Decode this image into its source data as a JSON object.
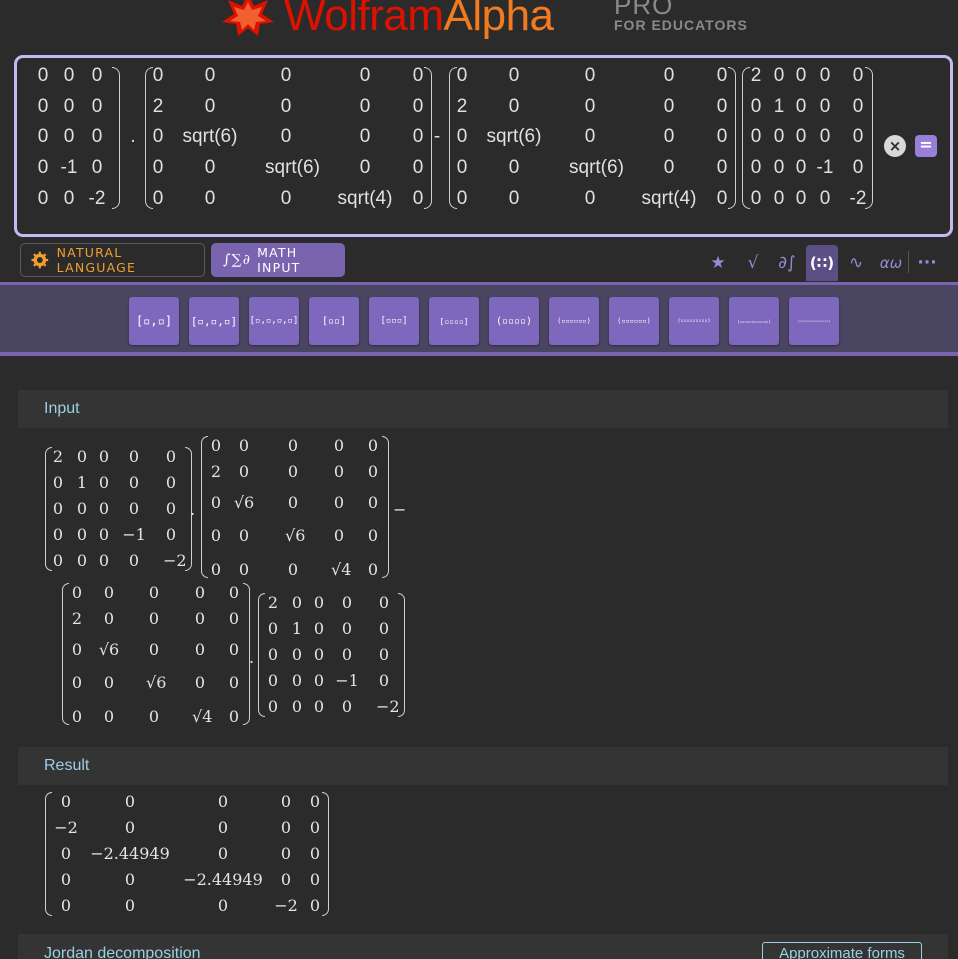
{
  "brand": {
    "name_part1": "Wolfram",
    "name_part2": "Alpha",
    "tier": "PRO",
    "audience": "FOR EDUCATORS"
  },
  "query": {
    "tokens": [
      "0",
      "0",
      "0",
      "0",
      "0",
      "0",
      "0",
      "0",
      "0",
      "0",
      "-1",
      "0",
      "0",
      "0",
      "-2",
      ".",
      "0",
      "0",
      "0",
      "0",
      "0",
      "2",
      "0",
      "0",
      "0",
      "0",
      "0",
      "sqrt(6)",
      "0",
      "0",
      "0",
      "0",
      "0",
      "sqrt(6)",
      "0",
      "0",
      "0",
      "0",
      "0",
      "sqrt(4)",
      "0",
      "-",
      "0",
      "0",
      "0",
      "0",
      "0",
      "2",
      "0",
      "0",
      "0",
      "0",
      "0",
      "sqrt(6)",
      "0",
      "0",
      "0",
      "0",
      "0",
      "sqrt(6)",
      "0",
      "0",
      "0",
      "0",
      "0",
      "sqrt(4)",
      "0",
      "2",
      "0",
      "0",
      "0",
      "0",
      "0",
      "1",
      "0",
      "0",
      "0",
      "0",
      "0",
      "0",
      "0",
      "0",
      "0",
      "0",
      "0",
      "-1",
      "0",
      "0",
      "0",
      "0",
      "0",
      "-2"
    ]
  },
  "buttons": {
    "clear": "×",
    "compute": "="
  },
  "modes": {
    "natural_language": "NATURAL LANGUAGE",
    "math_input": "MATH INPUT",
    "math_icon": "∫∑∂"
  },
  "toolbar": [
    {
      "icon": "star-icon",
      "glyph": "★"
    },
    {
      "icon": "sqrt-icon",
      "glyph": "√"
    },
    {
      "icon": "calculus-icon",
      "glyph": "∂∫"
    },
    {
      "icon": "matrix-icon",
      "glyph": "(∷)"
    },
    {
      "icon": "wave-icon",
      "glyph": "∿"
    },
    {
      "icon": "greek-icon",
      "glyph": "αω"
    },
    {
      "icon": "more-icon",
      "glyph": "···"
    }
  ],
  "templates": [
    "[▫,▫]",
    "[▫,▫,▫]",
    "[▫,▫,▫,▫]",
    "[▫▫]",
    "[▫▫▫]",
    "[▫▫▫▫]",
    "(▫▫▫▫)",
    "(▫▫▫▫▫▫)",
    "(▫▫▫▫▫▫)",
    "(▫▫▫▫▫▫▫▫▫)",
    "(▫▫▫▫▫▫▫▫▫▫▫▫)",
    "(▫▫▫▫▫▫▫▫▫▫▫▫▫▫▫▫)"
  ],
  "pods": {
    "input": {
      "title": "Input",
      "m1": [
        [
          "2",
          "0",
          "0",
          "0",
          "0"
        ],
        [
          "0",
          "1",
          "0",
          "0",
          "0"
        ],
        [
          "0",
          "0",
          "0",
          "0",
          "0"
        ],
        [
          "0",
          "0",
          "0",
          "−1",
          "0"
        ],
        [
          "0",
          "0",
          "0",
          "0",
          "−2"
        ]
      ],
      "m2": [
        [
          "0",
          "0",
          "0",
          "0",
          "0"
        ],
        [
          "2",
          "0",
          "0",
          "0",
          "0"
        ],
        [
          "0",
          "√6",
          "0",
          "0",
          "0"
        ],
        [
          "0",
          "0",
          "√6",
          "0",
          "0"
        ],
        [
          "0",
          "0",
          "0",
          "√4",
          "0"
        ]
      ],
      "dot": ".",
      "minus": "−"
    },
    "result": {
      "title": "Result",
      "matrix": [
        [
          "0",
          "0",
          "0",
          "0",
          "0"
        ],
        [
          "−2",
          "0",
          "0",
          "0",
          "0"
        ],
        [
          "0",
          "−2.44949",
          "0",
          "0",
          "0"
        ],
        [
          "0",
          "0",
          "−2.44949",
          "0",
          "0"
        ],
        [
          "0",
          "0",
          "0",
          "−2",
          "0"
        ]
      ]
    },
    "jordan": {
      "title": "Jordan decomposition",
      "approx_button": "Approximate forms"
    }
  }
}
